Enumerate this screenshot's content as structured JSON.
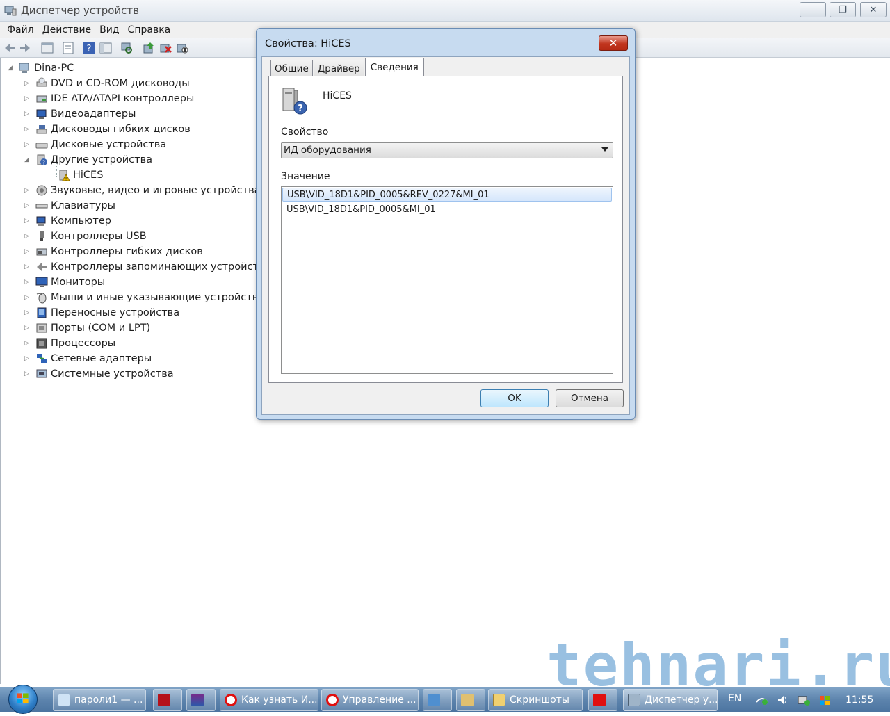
{
  "window": {
    "title": "Диспетчер устройств",
    "menu": [
      "Файл",
      "Действие",
      "Вид",
      "Справка"
    ],
    "controls": {
      "minimize": "—",
      "restore": "❐",
      "close": "✕"
    }
  },
  "tree": {
    "root": "Dina-PC",
    "items": [
      {
        "label": "DVD и CD-ROM дисководы",
        "icon": "dvd-drive-icon"
      },
      {
        "label": "IDE ATA/ATAPI контроллеры",
        "icon": "ide-controller-icon"
      },
      {
        "label": "Видеоадаптеры",
        "icon": "display-adapter-icon"
      },
      {
        "label": "Дисководы гибких дисков",
        "icon": "floppy-drive-icon"
      },
      {
        "label": "Дисковые устройства",
        "icon": "disk-drive-icon"
      },
      {
        "label": "Другие устройства",
        "icon": "unknown-device-icon"
      },
      {
        "label": "HiCES",
        "icon": "warning-device-icon"
      },
      {
        "label": "Звуковые, видео и игровые устройства",
        "icon": "sound-icon"
      },
      {
        "label": "Клавиатуры",
        "icon": "keyboard-icon"
      },
      {
        "label": "Компьютер",
        "icon": "computer-icon"
      },
      {
        "label": "Контроллеры USB",
        "icon": "usb-icon"
      },
      {
        "label": "Контроллеры гибких дисков",
        "icon": "floppy-controller-icon"
      },
      {
        "label": "Контроллеры запоминающих устройств",
        "icon": "storage-controller-icon"
      },
      {
        "label": "Мониторы",
        "icon": "monitor-icon"
      },
      {
        "label": "Мыши и иные указывающие устройства",
        "icon": "mouse-icon"
      },
      {
        "label": "Переносные устройства",
        "icon": "portable-device-icon"
      },
      {
        "label": "Порты (COM и LPT)",
        "icon": "port-icon"
      },
      {
        "label": "Процессоры",
        "icon": "processor-icon"
      },
      {
        "label": "Сетевые адаптеры",
        "icon": "network-adapter-icon"
      },
      {
        "label": "Системные устройства",
        "icon": "system-device-icon"
      }
    ]
  },
  "dialog": {
    "title": "Свойства: HiCES",
    "close": "✕",
    "tabs": [
      "Общие",
      "Драйвер",
      "Сведения"
    ],
    "active_tab": "Сведения",
    "device_name": "HiCES",
    "property_label": "Свойство",
    "property_value": "ИД оборудования",
    "value_label": "Значение",
    "values": [
      "USB\\VID_18D1&PID_0005&REV_0227&MI_01",
      "USB\\VID_18D1&PID_0005&MI_01"
    ],
    "ok": "OK",
    "cancel": "Отмена"
  },
  "watermark": "tehnari.ru",
  "taskbar": {
    "buttons": [
      {
        "label": "пароли1 — ...",
        "icon": "notepad-icon"
      },
      {
        "label": "",
        "icon": "pdf-icon"
      },
      {
        "label": "",
        "icon": "archive-icon"
      },
      {
        "label": "Как узнать И...",
        "icon": "yandex-browser-icon"
      },
      {
        "label": "Управление ...",
        "icon": "yandex-browser-icon"
      },
      {
        "label": "",
        "icon": "screenshot-tool-icon"
      },
      {
        "label": "",
        "icon": "paint-icon"
      },
      {
        "label": "Скриншоты",
        "icon": "folder-icon"
      },
      {
        "label": "",
        "icon": "yandex-icon"
      },
      {
        "label": "Диспетчер у...",
        "icon": "device-manager-icon"
      }
    ],
    "lang": "EN",
    "clock": "11:55"
  },
  "colors": {
    "dialog_frame": "#c7dbf0",
    "close_red": "#c1351e",
    "taskbar": "#5d84ad",
    "selection": "#d5e6fb",
    "watermark": "#468cc8"
  }
}
